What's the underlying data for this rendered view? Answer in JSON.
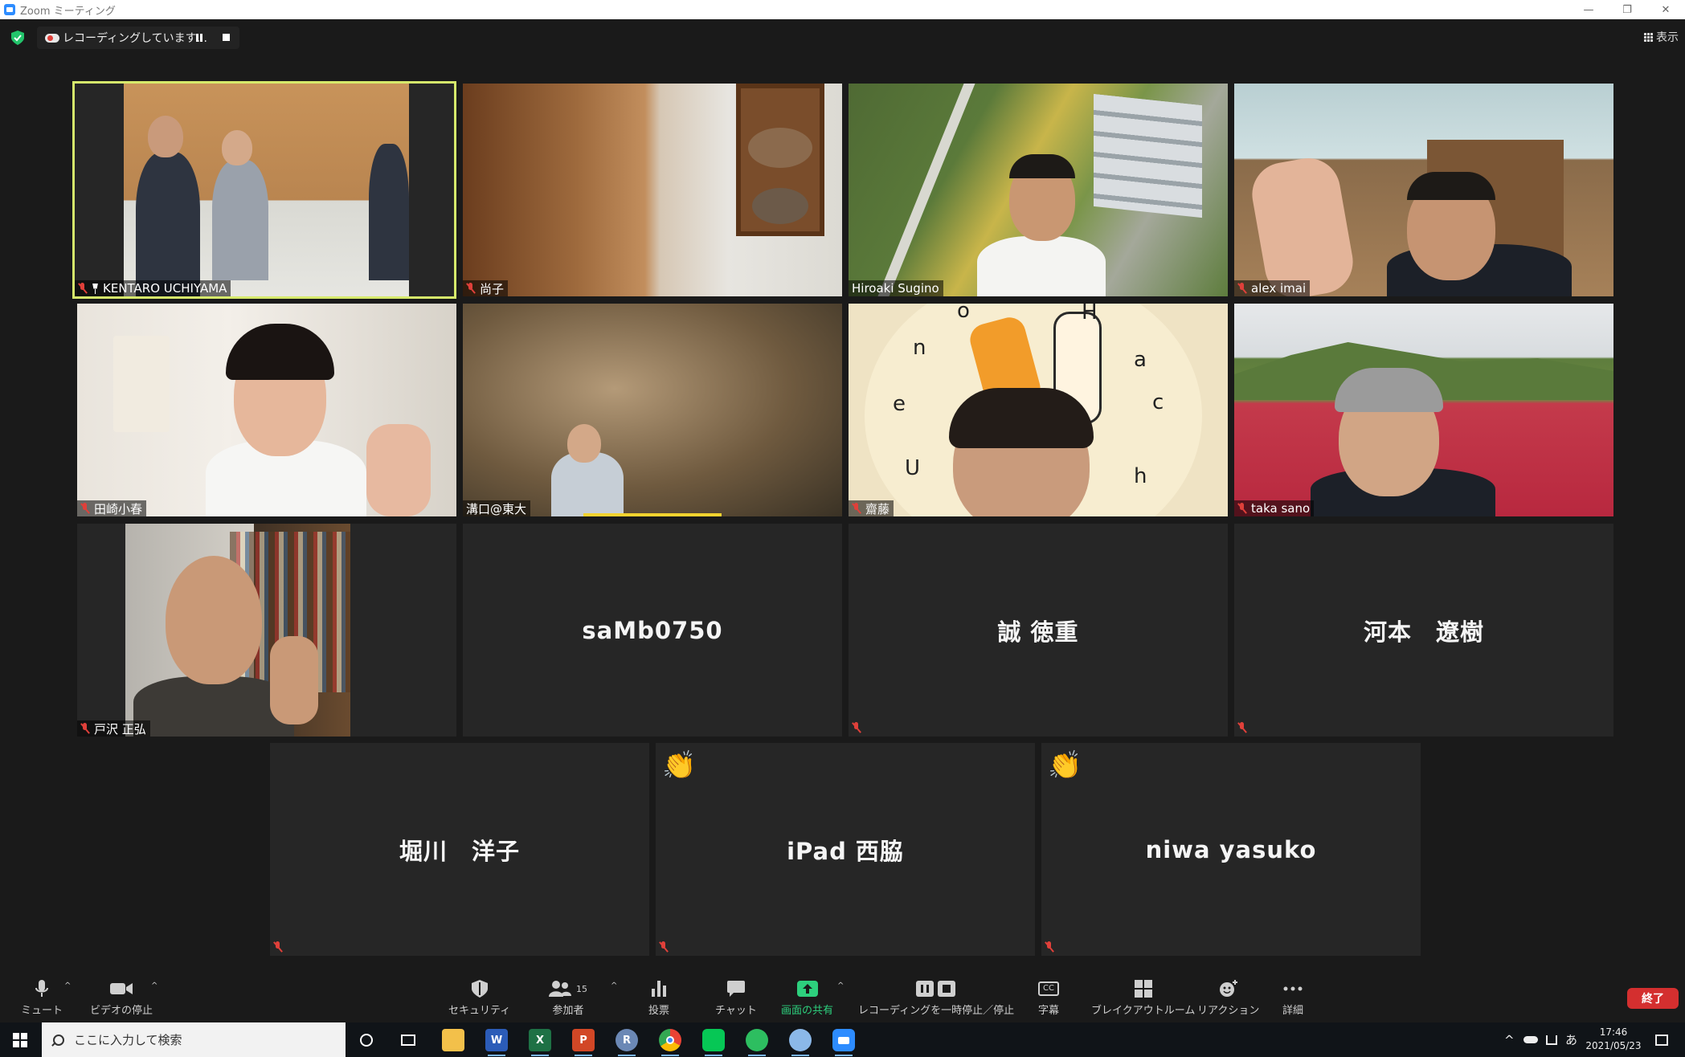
{
  "window": {
    "title": "Zoom ミーティング",
    "minimize": "—",
    "maximize": "❐",
    "close": "✕"
  },
  "header": {
    "recording_text": "レコーディングしています...",
    "view_label": "表示"
  },
  "participants": [
    {
      "name": "KENTARO UCHIYAMA",
      "pinned": true,
      "muted": true,
      "active": true
    },
    {
      "name": "尚子",
      "muted": true
    },
    {
      "name": "Hiroaki Sugino",
      "muted": false
    },
    {
      "name": "alex imai",
      "muted": true
    },
    {
      "name": "田崎小春",
      "muted": true
    },
    {
      "name": "溝口@東大",
      "muted": false
    },
    {
      "name": "齋藤",
      "muted": true
    },
    {
      "name": "taka sano",
      "muted": true
    },
    {
      "name": "戸沢 正弘",
      "muted": true
    },
    {
      "name": "saMb0750",
      "muted": false
    },
    {
      "name": "誠 徳重",
      "muted": true
    },
    {
      "name": "河本　遼樹",
      "muted": true
    },
    {
      "name": "堀川　洋子",
      "muted": true
    },
    {
      "name": "iPad 西脇",
      "muted": true,
      "reaction": "👏"
    },
    {
      "name": "niwa yasuko",
      "muted": true,
      "reaction": "👏"
    }
  ],
  "clock_tile": {
    "letters": [
      "o",
      "H",
      "n",
      "a",
      "e",
      "c",
      "U",
      "h"
    ]
  },
  "toolbar": {
    "mute": "ミュート",
    "stop_video": "ビデオの停止",
    "security": "セキュリティ",
    "participants": "参加者",
    "participants_count": "15",
    "polls": "投票",
    "chat": "チャット",
    "share_screen": "画面の共有",
    "recording": "レコーディングを一時停止／停止",
    "captions": "字幕",
    "captions_icon_text": "CC",
    "breakout": "ブレイクアウトルーム",
    "reactions": "リアクション",
    "more": "詳細",
    "end": "終了"
  },
  "taskbar": {
    "search_placeholder": "ここに入力して検索",
    "ime": "あ",
    "time": "17:46",
    "date": "2021/05/23",
    "apps": [
      "cortana",
      "task-view",
      "file-explorer",
      "word",
      "excel",
      "powerpoint",
      "r",
      "chrome",
      "line",
      "evernote",
      "paint",
      "zoom"
    ]
  },
  "colors": {
    "active_speaker_border": "#d6e96b",
    "muted_red": "#e0403a",
    "share_green": "#2dd07d",
    "end_red": "#d42f2f",
    "background": "#1a1a1a",
    "tile": "#262626"
  }
}
